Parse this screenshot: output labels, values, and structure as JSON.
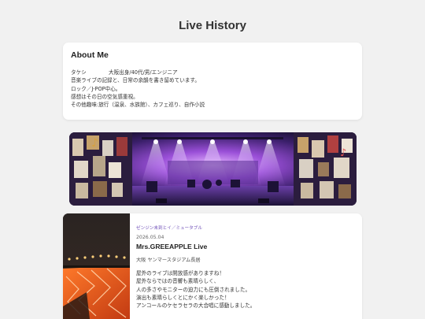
{
  "page": {
    "title": "Live History"
  },
  "about": {
    "heading": "About Me",
    "name": "タケシ",
    "profile": "大阪出身/40代/男/エンジニア",
    "lines": [
      "音楽ライブの記録と、日常の余韻を書き留めています。",
      "ロック／J-POP中心。",
      "感想はその日の空気感重視。",
      "その他趣味:旅行（温泉、水族館）、カフェ巡り、自作小説"
    ]
  },
  "banner": {
    "image": "concert-stage-illustration"
  },
  "live_entry": {
    "category": "ゼンジン未到とイ／ミュータブル",
    "date": "2026.05.04",
    "title": "Mrs.GREEAPPLE Live",
    "venue": "大阪 ヤンマースタジアム長居",
    "lines": [
      "屋外のライブは開放感がありますね！",
      "屋外ならではの音響も素晴らしく、",
      "人の多さやモニターの迫力にも圧倒されました。",
      "演出も素晴らしくとにかく楽しかった！",
      "アンコールのケセラセラの大合唱に感動しました。"
    ],
    "photo": "stadium-stage-photo"
  }
}
